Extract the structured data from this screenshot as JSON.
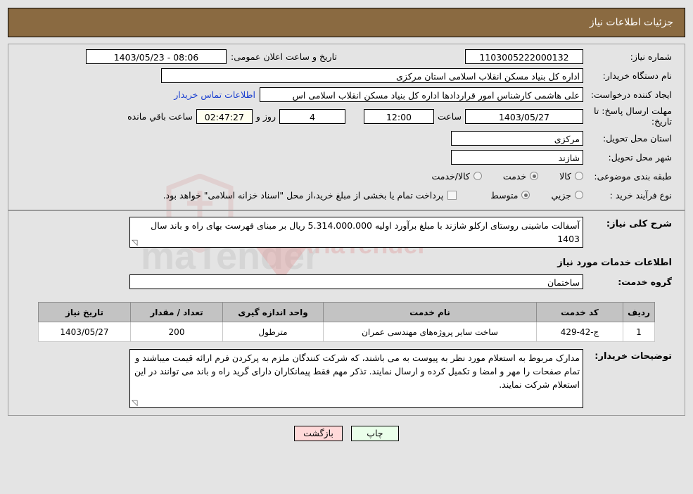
{
  "header": {
    "title": "جزئیات اطلاعات نیاز"
  },
  "form": {
    "need_number_label": "شماره نیاز:",
    "need_number_value": "1103005222000132",
    "announce_datetime_label": "تاریخ و ساعت اعلان عمومی:",
    "announce_datetime_value": "08:06 - 1403/05/23",
    "buyer_org_label": "نام دستگاه خریدار:",
    "buyer_org_value": "اداره کل بنیاد مسکن انقلاب اسلامی استان مرکزی",
    "requester_label": "ایجاد کننده درخواست:",
    "requester_value": "علی هاشمی کارشناس امور قراردادها اداره کل بنیاد مسکن انقلاب اسلامی اس",
    "contact_link": "اطلاعات تماس خریدار",
    "deadline_label": "مهلت ارسال پاسخ: تا تاریخ:",
    "deadline_date": "1403/05/27",
    "hour_label": "ساعت",
    "hour_value": "12:00",
    "days_value": "4",
    "days_label": "روز و",
    "countdown_value": "02:47:27",
    "countdown_label": "ساعت باقي مانده",
    "province_label": "استان محل تحویل:",
    "province_value": "مرکزی",
    "city_label": "شهر محل تحویل:",
    "city_value": "شازند",
    "category_label": "طبقه بندی موضوعی:",
    "category_options": [
      {
        "label": "کالا",
        "selected": false
      },
      {
        "label": "خدمت",
        "selected": true
      },
      {
        "label": "کالا/خدمت",
        "selected": false
      }
    ],
    "process_label": "نوع فرآیند خرید :",
    "process_options": [
      {
        "label": "جزیي",
        "selected": false
      },
      {
        "label": "متوسط",
        "selected": true
      }
    ],
    "treasury_checkbox_label": "پرداخت تمام یا بخشی از مبلغ خرید،از محل \"اسناد خزانه اسلامی\" خواهد بود.",
    "treasury_checked": false
  },
  "description": {
    "label": "شرح کلی نیاز:",
    "value": "آسفالت ماشینی روستای ارکلو شازند با مبلغ برآورد اولیه  5.314.000.000 ریال بر مبنای فهرست بهای راه و باند سال 1403"
  },
  "services_section": {
    "title": "اطلاعات خدمات مورد نیاز",
    "group_label": "گروه خدمت:",
    "group_value": "ساختمان"
  },
  "table": {
    "columns": [
      "ردیف",
      "کد خدمت",
      "نام خدمت",
      "واحد اندازه گیری",
      "تعداد / مقدار",
      "تاریخ نیاز"
    ],
    "rows": [
      {
        "row": "1",
        "code": "ج-42-429",
        "name": "ساخت سایر پروژه‌های مهندسی عمران",
        "unit": "مترطول",
        "qty": "200",
        "date": "1403/05/27"
      }
    ]
  },
  "buyer_notes": {
    "label": "توضیحات خریدار:",
    "value": "مدارک مربوط به استعلام مورد نظر به پیوست به می باشند، که شرکت کنندگان ملزم به پرکردن فرم ارائه قیمت میباشند و تمام صفحات را مهر و امضا و تکمیل کرده و ارسال نمایند. تذکر مهم فقط پیمانکاران دارای گرید راه و باند می توانند در این استعلام شرکت نمایند."
  },
  "footer": {
    "print_label": "چاپ",
    "back_label": "بازگشت"
  },
  "colors": {
    "header_bg": "#8a6a41",
    "header_text": "#ffffff",
    "link": "#1a3fd0",
    "page_bg": "#e4e4e4",
    "table_header_bg": "#c3c3c3",
    "countdown_bg": "#fffff0",
    "print_btn_bg": "#eaffea",
    "back_btn_bg": "#ffd9d9"
  },
  "watermark": {
    "text_main": "AriaTender",
    "text_suffix": ".net",
    "text_alt": "maTender"
  }
}
